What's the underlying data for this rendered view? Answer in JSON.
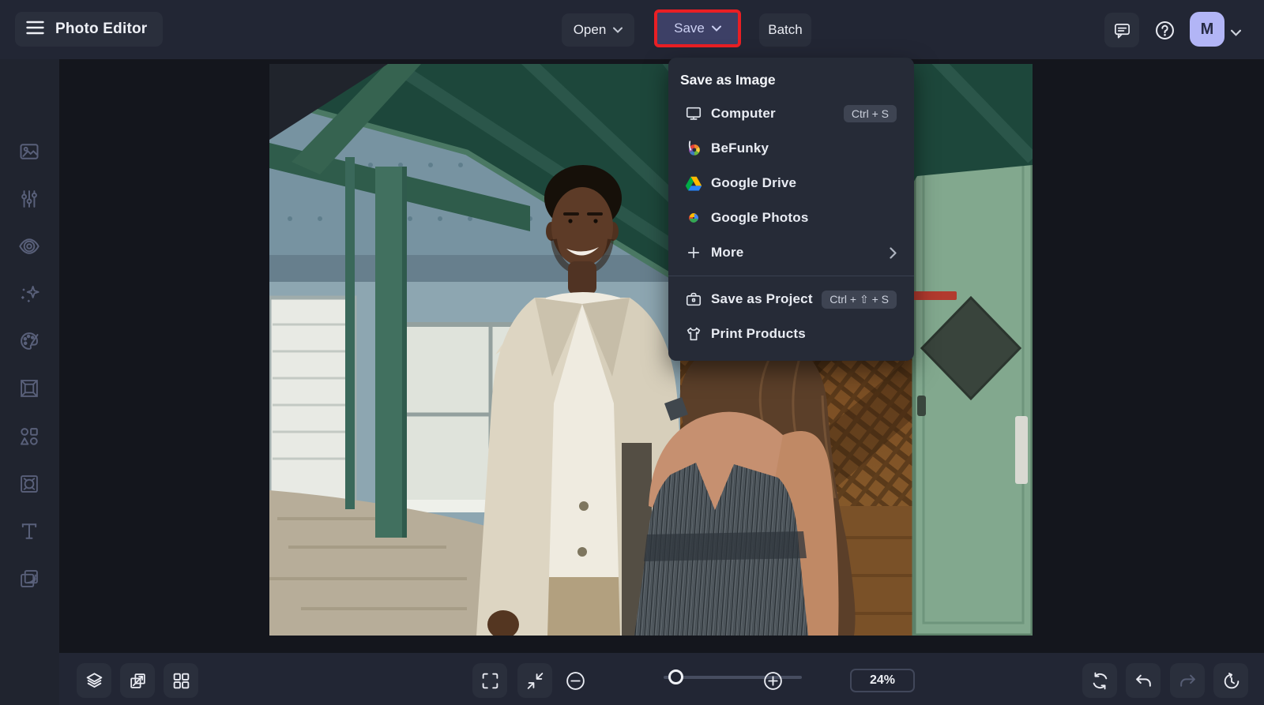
{
  "app": {
    "title": "Photo Editor"
  },
  "topbar": {
    "open_label": "Open",
    "save_label": "Save",
    "batch_label": "Batch",
    "avatar_initial": "M"
  },
  "save_menu": {
    "header": "Save as Image",
    "items": [
      {
        "label": "Computer",
        "shortcut": "Ctrl + S",
        "icon": "computer-icon"
      },
      {
        "label": "BeFunky",
        "icon": "befunky-icon"
      },
      {
        "label": "Google Drive",
        "icon": "google-drive-icon"
      },
      {
        "label": "Google Photos",
        "icon": "google-photos-icon"
      },
      {
        "label": "More",
        "icon": "plus-icon"
      }
    ],
    "project": {
      "label": "Save as Project",
      "shortcut": "Ctrl + ⇧ + S",
      "icon": "briefcase-icon"
    },
    "print": {
      "label": "Print Products",
      "icon": "tshirt-icon"
    }
  },
  "sidebar": {
    "tools": [
      {
        "icon": "image-icon",
        "name": "edit"
      },
      {
        "icon": "sliders-icon",
        "name": "adjust"
      },
      {
        "icon": "eye-icon",
        "name": "touch-up"
      },
      {
        "icon": "sparkles-icon",
        "name": "effects"
      },
      {
        "icon": "palette-icon",
        "name": "artsy"
      },
      {
        "icon": "frame-icon",
        "name": "frames"
      },
      {
        "icon": "shapes-icon",
        "name": "graphics"
      },
      {
        "icon": "pattern-icon",
        "name": "overlays"
      },
      {
        "icon": "text-icon",
        "name": "text"
      },
      {
        "icon": "textures-icon",
        "name": "textures"
      }
    ]
  },
  "bottombar": {
    "zoom_level": "24%"
  },
  "colors": {
    "save_highlight_border": "#ea1f24",
    "save_button_bg": "#3d4066",
    "avatar_bg": "#b2b5f6",
    "bar_bg": "#222634",
    "workspace_bg": "#14161d",
    "menu_bg": "#262b37"
  }
}
